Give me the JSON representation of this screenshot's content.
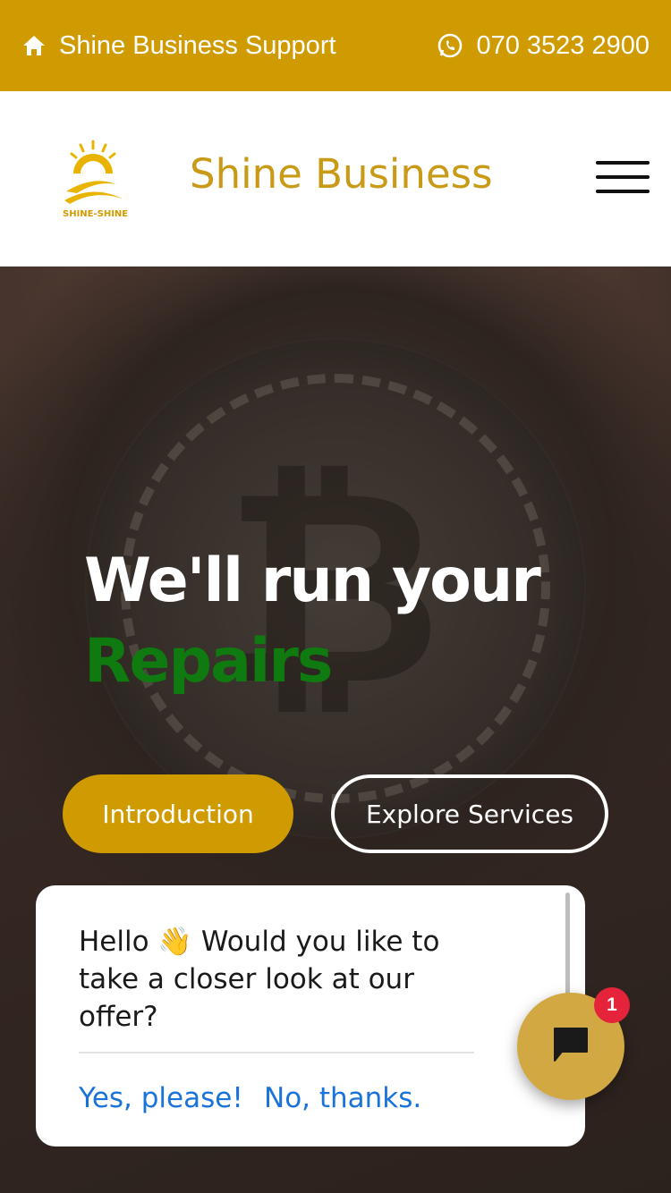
{
  "topbar": {
    "support_label": "Shine Business Support",
    "phone": "070 3523 2900",
    "home_icon": "home-icon",
    "whatsapp_icon": "whatsapp-icon"
  },
  "header": {
    "logo_text": "SHINE-SHINE",
    "brand": "Shine Business",
    "menu_icon": "hamburger-menu-icon"
  },
  "hero": {
    "headline_line1": "We'll run your",
    "headline_line2": "Repairs",
    "intro_button": "Introduction",
    "explore_button": "Explore Services"
  },
  "popup": {
    "message": "Hello 👋 Would you like to take a closer look at our offer?",
    "yes_label": "Yes, please!",
    "no_label": "No, thanks."
  },
  "chat": {
    "badge_count": "1",
    "chat_icon": "chat-bubble-icon"
  },
  "colors": {
    "accent": "#cf9b00",
    "brand_text": "#c99a16",
    "headline_green": "#0f7a0f",
    "link_blue": "#1a73d9",
    "badge_red": "#e5233b"
  }
}
